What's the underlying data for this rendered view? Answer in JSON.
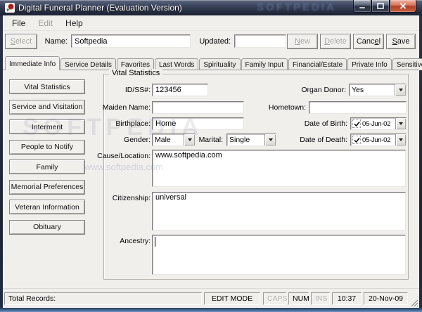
{
  "window": {
    "title": "Digital Funeral Planner (Evaluation Version)"
  },
  "watermarks": {
    "titlebar": "SOFTPEDIA",
    "large": "SOFTPEDIA",
    "small": "www.softpedia.com"
  },
  "menu": {
    "items": [
      {
        "label": "File"
      },
      {
        "label": "Edit"
      },
      {
        "label": "Help"
      }
    ]
  },
  "toolbar": {
    "name_label": "Name:",
    "name_value": "Softpedia",
    "updated_label": "Updated:",
    "updated_value": "",
    "select": {
      "accel": "S",
      "rest": "elect"
    },
    "new": {
      "accel": "N",
      "rest": "ew"
    },
    "delete": {
      "accel": "D",
      "rest": "elete"
    },
    "cancel": {
      "pre": "Canc",
      "accel": "e",
      "rest": "l"
    },
    "save": {
      "accel": "S",
      "rest": "ave"
    }
  },
  "tabs": [
    "Immediate Info",
    "Service Details",
    "Favorites",
    "Last Words",
    "Spirituality",
    "Family Input",
    "Financial/Estate",
    "Private Info",
    "Sensitive"
  ],
  "sidebar": {
    "buttons": [
      "Vital Statistics",
      "Service and Visitation",
      "Interment",
      "People to Notify",
      "Family",
      "Memorial Preferences",
      "Veteran Information",
      "Obituary"
    ]
  },
  "form": {
    "group_title": "Vital Statistics",
    "id_label": "ID/SS#:",
    "id_value": "123456",
    "organ_donor_label": "Organ Donor:",
    "organ_donor_value": "Yes",
    "maiden_label": "Maiden Name:",
    "maiden_value": "",
    "hometown_label": "Hometown:",
    "hometown_value": "",
    "birthplace_label": "Birthplace:",
    "birthplace_value": "Home",
    "dob_label": "Date of Birth:",
    "dob_value": "05-Jun-02",
    "gender_label": "Gender:",
    "gender_value": "Male",
    "marital_label": "Marital:",
    "marital_value": "Single",
    "dod_label": "Date of Death:",
    "dod_value": "05-Jun-02",
    "cause_label": "Cause/Location:",
    "cause_value": "www.softpedia.com",
    "citizenship_label": "Citizenship:",
    "citizenship_value": "universal",
    "ancestry_label": "Ancestry:",
    "ancestry_value": ""
  },
  "statusbar": {
    "total_records": "Total Records:",
    "mode": "EDIT MODE",
    "caps": "CAPS",
    "num": "NUM",
    "ins": "INS",
    "time": "10:37",
    "date": "20-Nov-09"
  },
  "colors": {
    "close_button": "#c25238",
    "titlebar": "#2b3347",
    "client_bg": "#f1efec"
  }
}
